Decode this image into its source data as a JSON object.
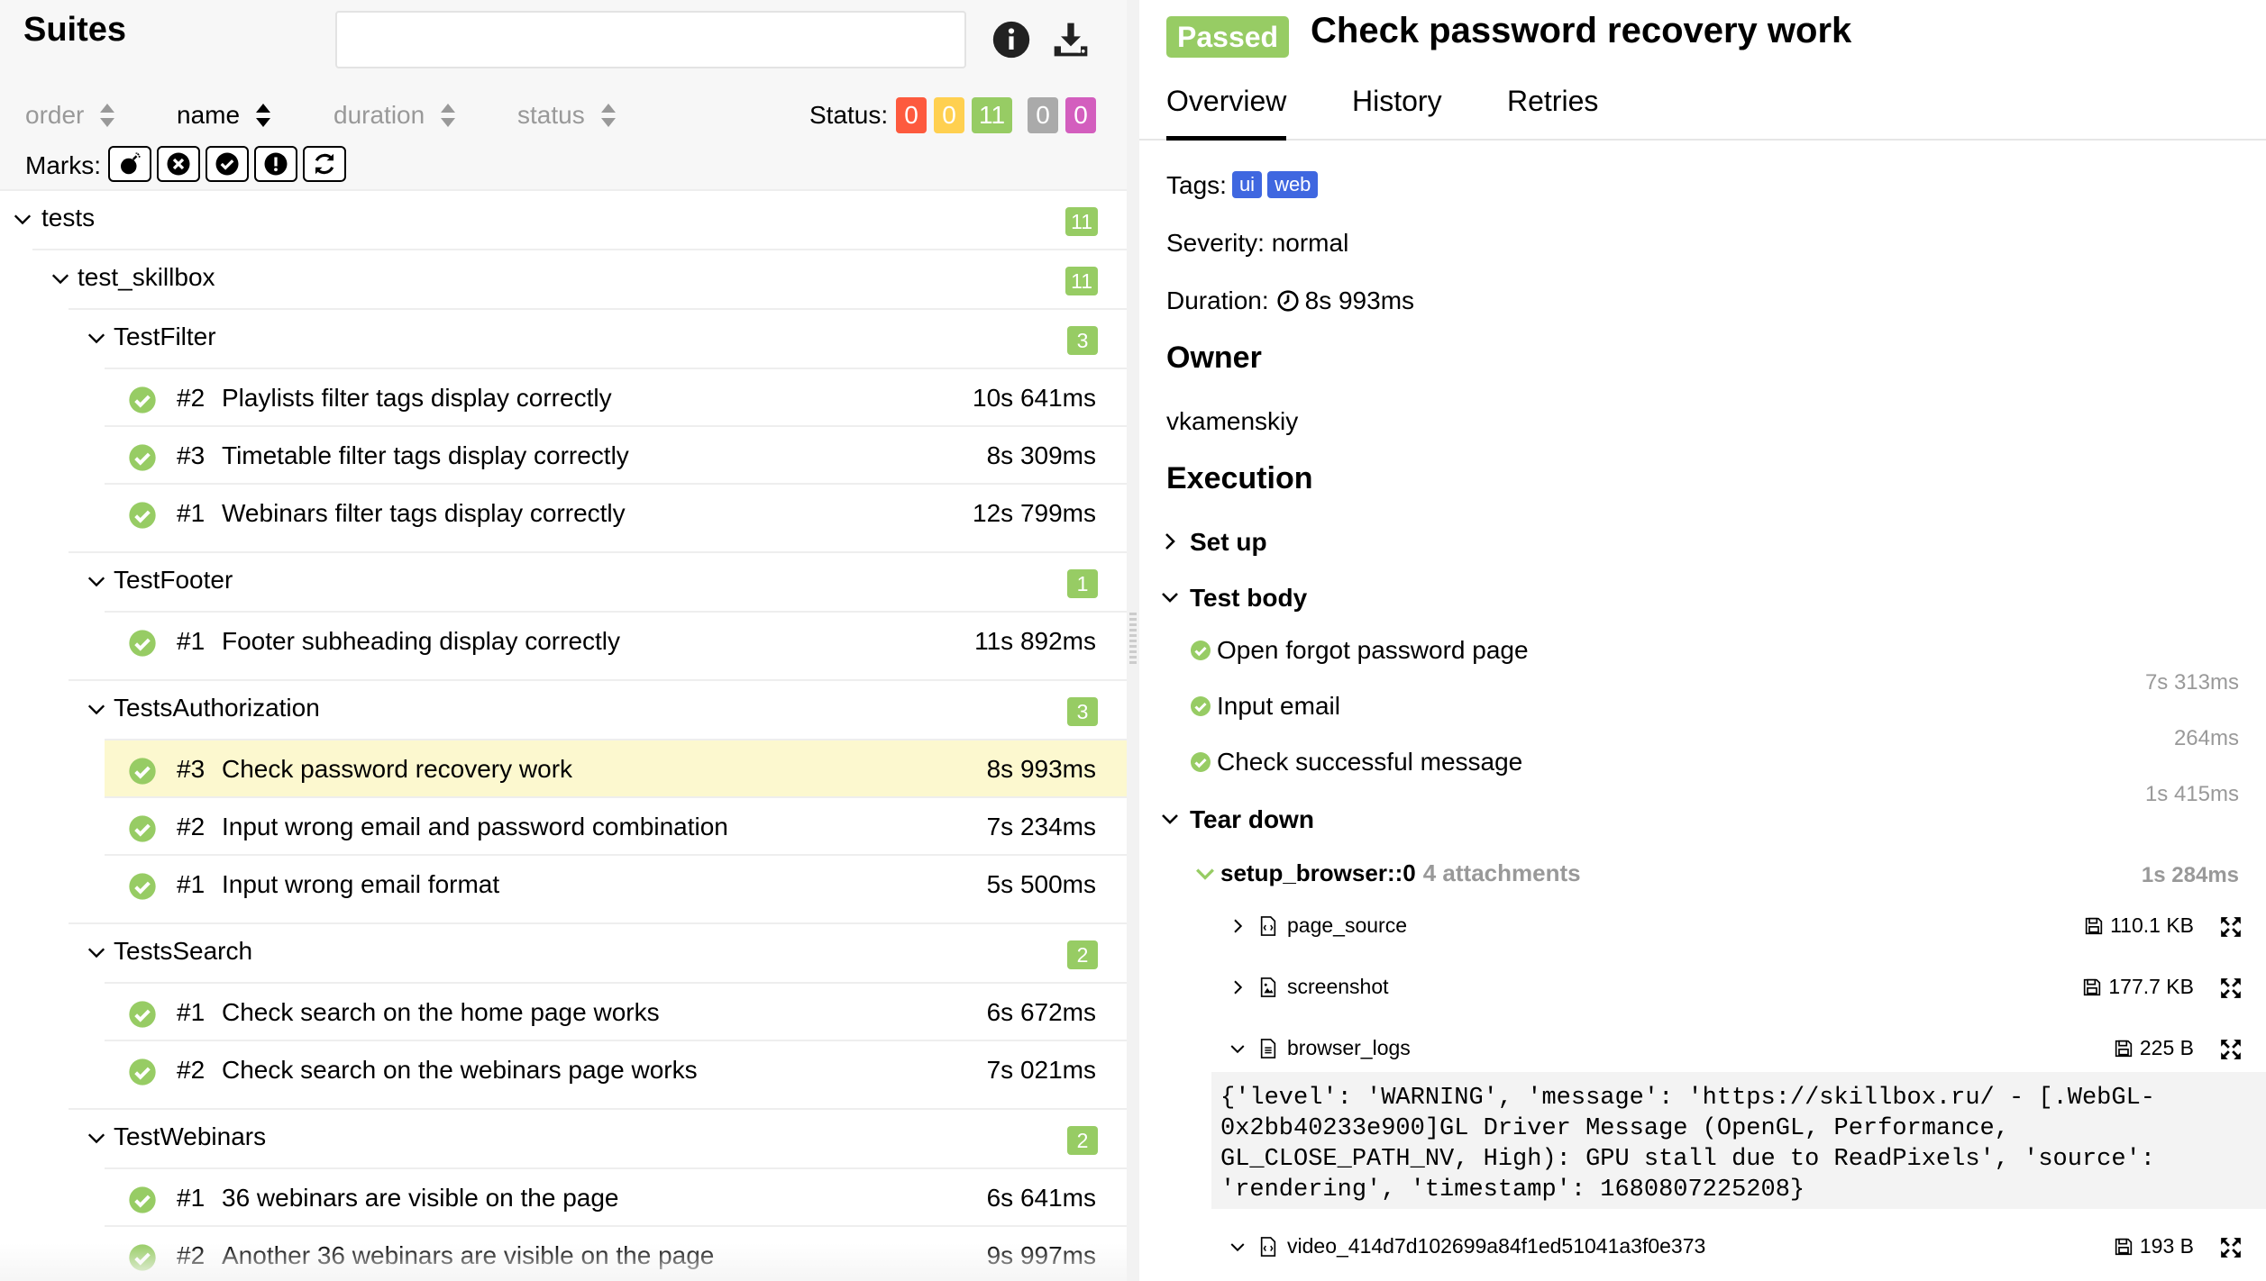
{
  "left": {
    "title": "Suites",
    "sort": {
      "order": "order",
      "name": "name",
      "duration": "duration",
      "status": "status"
    },
    "status_label": "Status:",
    "status_counts": [
      {
        "value": "0",
        "color": "#fd5a3e"
      },
      {
        "value": "0",
        "color": "#ffd050"
      },
      {
        "value": "11",
        "color": "#97cc64"
      },
      {
        "value": "0",
        "color": "#aaaaaa"
      },
      {
        "value": "0",
        "color": "#d35ebe"
      }
    ],
    "marks_label": "Marks:",
    "tree": {
      "root": {
        "name": "tests",
        "count": "11"
      },
      "module": {
        "name": "test_skillbox",
        "count": "11"
      },
      "groups": [
        {
          "name": "TestFilter",
          "count": "3",
          "tests": [
            {
              "num": "#2",
              "name": "Playlists filter tags display correctly",
              "duration": "10s 641ms"
            },
            {
              "num": "#3",
              "name": "Timetable filter tags display correctly",
              "duration": "8s 309ms"
            },
            {
              "num": "#1",
              "name": "Webinars filter tags display correctly",
              "duration": "12s 799ms"
            }
          ]
        },
        {
          "name": "TestFooter",
          "count": "1",
          "tests": [
            {
              "num": "#1",
              "name": "Footer subheading display correctly",
              "duration": "11s 892ms"
            }
          ]
        },
        {
          "name": "TestsAuthorization",
          "count": "3",
          "tests": [
            {
              "num": "#3",
              "name": "Check password recovery work",
              "duration": "8s 993ms"
            },
            {
              "num": "#2",
              "name": "Input wrong email and password combination",
              "duration": "7s 234ms"
            },
            {
              "num": "#1",
              "name": "Input wrong email format",
              "duration": "5s 500ms"
            }
          ]
        },
        {
          "name": "TestsSearch",
          "count": "2",
          "tests": [
            {
              "num": "#1",
              "name": "Check search on the home page works",
              "duration": "6s 672ms"
            },
            {
              "num": "#2",
              "name": "Check search on the webinars page works",
              "duration": "7s 021ms"
            }
          ]
        },
        {
          "name": "TestWebinars",
          "count": "2",
          "tests": [
            {
              "num": "#1",
              "name": "36 webinars are visible on the page",
              "duration": "6s 641ms"
            },
            {
              "num": "#2",
              "name": "Another 36 webinars are visible on the page",
              "duration": "9s 997ms"
            }
          ]
        }
      ]
    }
  },
  "right": {
    "status_badge": "Passed",
    "title": "Check password recovery work",
    "tabs": [
      "Overview",
      "History",
      "Retries"
    ],
    "tags_label": "Tags:",
    "tags": [
      "ui",
      "web"
    ],
    "severity": "Severity: normal",
    "duration_label": "Duration:",
    "duration": "8s 993ms",
    "owner_heading": "Owner",
    "owner": "vkamenskiy",
    "execution_heading": "Execution",
    "setup": "Set up",
    "test_body": "Test body",
    "steps": [
      {
        "name": "Open forgot password page",
        "time": "7s 313ms"
      },
      {
        "name": "Input email",
        "time": "264ms"
      },
      {
        "name": "Check successful message",
        "time": "1s 415ms"
      }
    ],
    "teardown": "Tear down",
    "fixture": {
      "name": "setup_browser::0",
      "attachments": "4 attachments",
      "time": "1s 284ms"
    },
    "attachments": [
      {
        "name": "page_source",
        "size": "110.1 KB"
      },
      {
        "name": "screenshot",
        "size": "177.7 KB"
      },
      {
        "name": "browser_logs",
        "size": "225 B"
      },
      {
        "name": "video_414d7d102699a84f1ed51041a3f0e373",
        "size": "193 B"
      }
    ],
    "log_text": "{'level': 'WARNING', 'message': 'https://skillbox.ru/ - [.WebGL-0x2bb40233e900]GL Driver Message (OpenGL, Performance, GL_CLOSE_PATH_NV, High): GPU stall due to ReadPixels', 'source': 'rendering', 'timestamp': 1680807225208}"
  }
}
